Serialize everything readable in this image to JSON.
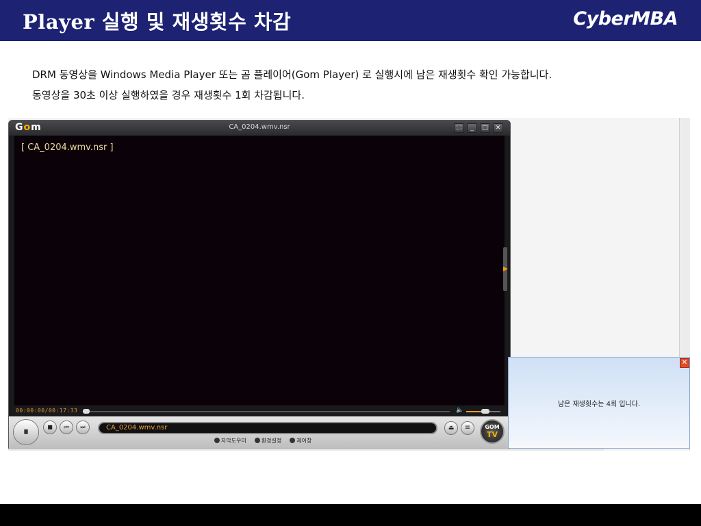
{
  "header": {
    "title": "Player 실행 및 재생횟수 차감",
    "brand": "CyberMBA"
  },
  "description": {
    "line1": "DRM 동영상을 Windows Media Player 또는 곰 플레이어(Gom Player) 로 실행시에 남은 재생횟수 확인 가능합니다.",
    "line2": "동영상을 30초 이상 실행하였을 경우 재생횟수 1회 차감됩니다."
  },
  "player": {
    "logo_g": "G",
    "logo_o": "o",
    "logo_m": "m",
    "window_title": "CA_0204.wmv.nsr",
    "screen_text": "[ CA_0204.wmv.nsr ]",
    "time": "00:00:00/00:17:33",
    "filename": "CA_0204.wmv.nsr",
    "volume_level": 0.55,
    "seek_progress": 0.0,
    "gomtv_top": "GOM",
    "gomtv_bottom": "TV",
    "links": [
      "자막도우미",
      "환경설정",
      "제어창"
    ],
    "icons": {
      "pause": "⏸",
      "stop": "■",
      "prev": "⏮",
      "next": "⏭",
      "eject": "⏏",
      "menu": "≡",
      "volume": "🔈",
      "close": "✕",
      "minimize": "_",
      "maximize": "□",
      "fullscreen": "⛶"
    }
  },
  "popup": {
    "message": "남은 재생횟수는 4회 입니다.",
    "close_label": "✕"
  },
  "colors": {
    "header_bg": "#1d2273",
    "accent_orange": "#ff9a00",
    "popup_close": "#e34b2a"
  }
}
